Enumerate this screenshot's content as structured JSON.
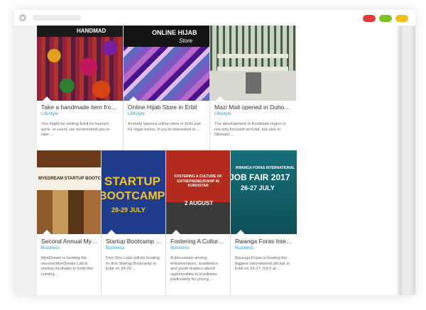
{
  "browser": {
    "controls": [
      "settings-icon",
      "close-control",
      "maximize-control",
      "minimize-control"
    ],
    "control_colors": {
      "close": "#e53a3a",
      "maximize": "#7cc122",
      "minimize": "#f3bd1b"
    }
  },
  "accent_color": "#2a9fbf",
  "cards": [
    {
      "title": "Take a handmade item from Er...",
      "category": "Lifestyle",
      "desc": "You might be visiting Erbil for tourism, work, or event, we recommend you to take ...",
      "image_text": "HANDMAD"
    },
    {
      "title": "Online Hijab Store in Erbil",
      "category": "Lifestyle",
      "desc": "A newly opened online store in Erbil just for Hijab lovers, if you're interested in ...",
      "image_text": "ONLINE HIJAB",
      "image_subtext": "Store"
    },
    {
      "title": "Mazi Mall opened in Duhok, Ku...",
      "category": "Lifestyle",
      "desc": "The development in Kurdistan region is not only focused on Erbil, but also in Slemani ..."
    },
    {
      "title": "Second Annual Myedr...",
      "category": "Business",
      "desc": "MyeDream is hosting the second MyeDream Lab & startup incubator in Erbil this coming ...",
      "image_text": "MYEDREAM STARTUP BOOTC"
    },
    {
      "title": "Startup Bootcamp 28-...",
      "category": "Business",
      "desc": "Five One Labs will be hosting its first Startup Bootcamp in Erbil on 28-29 ...",
      "image_text": "STARTUP",
      "image_text2": "BOOTCAMP",
      "image_subtext": "28-29 JULY"
    },
    {
      "title": "Fostering A Culture of...",
      "category": "Business",
      "desc": "A discussion among entrepreneurs, academics and youth leaders about opportunities in Kurdistan, particularly for young ...",
      "image_text": "FOSTERING A CULTURE OF ENTREPRENEURSHIP IN KURDISTAN",
      "image_subtext": "2 AUGUST"
    },
    {
      "title": "Rwanga Foras Interna...",
      "category": "Business",
      "desc": "Rwanga Foras is hosting the biggest international job fair in Erbil on 26-27 JULY at ...",
      "image_text": "RWANGA FORAS INTERNATIONAL",
      "image_text2": "JOB FAIR 2017",
      "image_subtext": "26-27 JULY"
    }
  ]
}
